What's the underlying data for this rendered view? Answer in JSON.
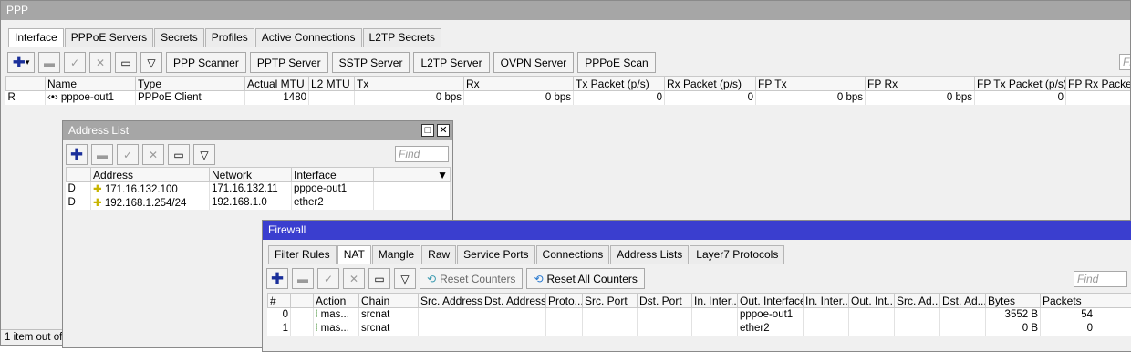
{
  "ppp": {
    "title": "PPP",
    "tabs": [
      "Interface",
      "PPPoE Servers",
      "Secrets",
      "Profiles",
      "Active Connections",
      "L2TP Secrets"
    ],
    "toolbar_buttons": [
      "PPP Scanner",
      "PPTP Server",
      "SSTP Server",
      "L2TP Server",
      "OVPN Server",
      "PPPoE Scan"
    ],
    "find_placeholder": "Fi",
    "columns": [
      "",
      "Name",
      "Type",
      "Actual MTU",
      "L2 MTU",
      "Tx",
      "Rx",
      "Tx Packet (p/s)",
      "Rx Packet (p/s)",
      "FP Tx",
      "FP Rx",
      "FP Tx Packet (p/s)",
      "FP Rx Packet ("
    ],
    "rows": [
      {
        "flag": "R",
        "name": "‹•› pppoe-out1",
        "type": "PPPoE Client",
        "actual_mtu": "1480",
        "l2_mtu": "",
        "tx": "0 bps",
        "rx": "0 bps",
        "tx_packet": "0",
        "rx_packet": "0",
        "fp_tx": "0 bps",
        "fp_rx": "0 bps",
        "fp_tx_packet": "0",
        "fp_rx_packet": ""
      }
    ],
    "status": "1 item out of"
  },
  "address_list": {
    "title": "Address List",
    "find_placeholder": "Find",
    "columns": [
      "",
      "Address",
      "Network",
      "Interface",
      ""
    ],
    "rows": [
      {
        "flag": "D",
        "address": "171.16.132.100",
        "network": "171.16.132.11",
        "interface": "pppoe-out1"
      },
      {
        "flag": "D",
        "address": "192.168.1.254/24",
        "network": "192.168.1.0",
        "interface": "ether2"
      }
    ]
  },
  "firewall": {
    "title": "Firewall",
    "tabs": [
      "Filter Rules",
      "NAT",
      "Mangle",
      "Raw",
      "Service Ports",
      "Connections",
      "Address Lists",
      "Layer7 Protocols"
    ],
    "reset_counters": "Reset Counters",
    "reset_all_counters": "Reset All Counters",
    "find_placeholder": "Find",
    "columns": [
      "#",
      "Action",
      "Chain",
      "Src. Address",
      "Dst. Address",
      "Proto...",
      "Src. Port",
      "Dst. Port",
      "In. Inter...",
      "Out. Interface",
      "In. Inter...",
      "Out. Int...",
      "Src. Ad...",
      "Dst. Ad...",
      "Bytes",
      "Packets"
    ],
    "rows": [
      {
        "num": "0",
        "action": "mas...",
        "chain": "srcnat",
        "out_interface": "pppoe-out1",
        "bytes": "3552 B",
        "packets": "54"
      },
      {
        "num": "1",
        "action": "mas...",
        "chain": "srcnat",
        "out_interface": "ether2",
        "bytes": "0 B",
        "packets": "0"
      }
    ]
  }
}
